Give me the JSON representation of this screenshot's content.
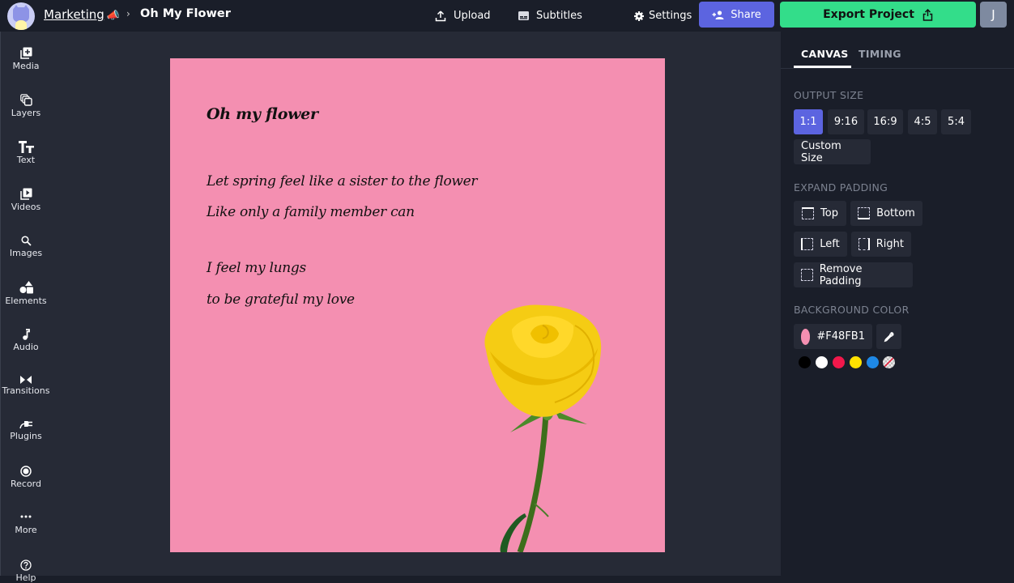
{
  "header": {
    "workspace": "Marketing",
    "workspace_emoji": "📣",
    "separator": "›",
    "project_title": "Oh My Flower",
    "upload_label": "Upload",
    "subtitles_label": "Subtitles",
    "settings_label": "Settings",
    "share_label": "Share",
    "export_label": "Export Project",
    "user_initial": "J"
  },
  "sidebar": {
    "items": [
      {
        "label": "Media",
        "icon": "media-add-icon"
      },
      {
        "label": "Layers",
        "icon": "layers-icon"
      },
      {
        "label": "Text",
        "icon": "text-icon"
      },
      {
        "label": "Videos",
        "icon": "video-icon"
      },
      {
        "label": "Images",
        "icon": "search-icon"
      },
      {
        "label": "Elements",
        "icon": "shapes-icon"
      },
      {
        "label": "Audio",
        "icon": "music-note-icon"
      },
      {
        "label": "Transitions",
        "icon": "transition-icon"
      },
      {
        "label": "Plugins",
        "icon": "plug-icon"
      },
      {
        "label": "Record",
        "icon": "record-icon"
      },
      {
        "label": "More",
        "icon": "more-dots-icon"
      },
      {
        "label": "Help",
        "icon": "help-icon"
      }
    ]
  },
  "canvas": {
    "background": "#F48FB1",
    "title": "Oh my flower",
    "lines": [
      "Let spring feel like a sister to the flower",
      "Like only a family member can",
      "I feel my lungs",
      "to be grateful my love"
    ],
    "image": "yellow-rose"
  },
  "panel": {
    "tabs": [
      {
        "label": "CANVAS",
        "active": true
      },
      {
        "label": "TIMING",
        "active": false
      }
    ],
    "output_size_label": "OUTPUT SIZE",
    "output_sizes": [
      "1:1",
      "9:16",
      "16:9",
      "4:5",
      "5:4"
    ],
    "output_size_selected": "1:1",
    "custom_size_label": "Custom Size",
    "expand_padding_label": "EXPAND PADDING",
    "padding_buttons": {
      "top": "Top",
      "bottom": "Bottom",
      "left": "Left",
      "right": "Right",
      "remove": "Remove Padding"
    },
    "background_color_label": "BACKGROUND COLOR",
    "background_color_value": "#F48FB1",
    "background_color_display": "#F48FB1",
    "preset_colors": [
      "#000000",
      "#FFFFFF",
      "#F2184B",
      "#FFE100",
      "#1E88E5",
      "transparent"
    ]
  },
  "colors": {
    "accent": "#5C64E0",
    "export": "#33DD8A"
  }
}
